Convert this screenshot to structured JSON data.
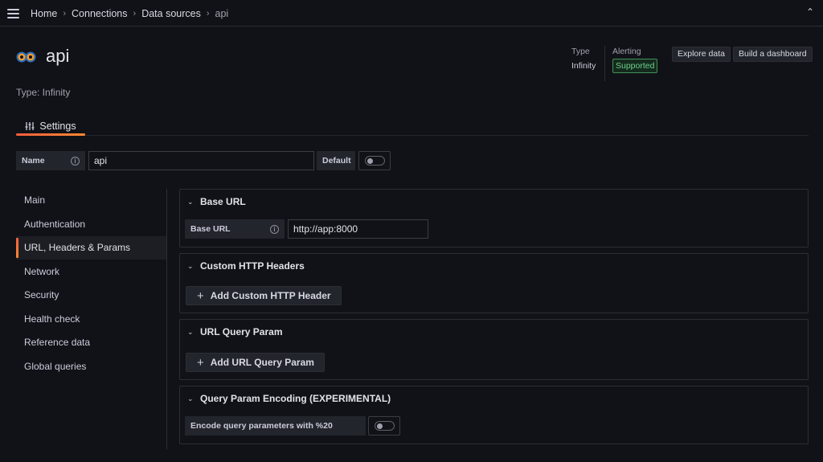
{
  "breadcrumb": {
    "home": "Home",
    "connections": "Connections",
    "data_sources": "Data sources",
    "current": "api"
  },
  "header": {
    "title": "api",
    "type_line": "Type: Infinity",
    "meta_type_label": "Type",
    "meta_type_value": "Infinity",
    "meta_alerting_label": "Alerting",
    "meta_alerting_badge": "Supported",
    "explore_button": "Explore data",
    "dashboard_button": "Build a dashboard"
  },
  "tabs": {
    "settings": "Settings"
  },
  "name_row": {
    "name_label": "Name",
    "name_value": "api",
    "default_label": "Default"
  },
  "side_nav": {
    "items": [
      "Main",
      "Authentication",
      "URL, Headers & Params",
      "Network",
      "Security",
      "Health check",
      "Reference data",
      "Global queries"
    ],
    "active_index": 2
  },
  "sections": {
    "base_url": {
      "title": "Base URL",
      "field_label": "Base URL",
      "field_value": "http://app:8000"
    },
    "headers": {
      "title": "Custom HTTP Headers",
      "button": "Add Custom HTTP Header"
    },
    "query": {
      "title": "URL Query Param",
      "button": "Add URL Query Param"
    },
    "encoding": {
      "title": "Query Param Encoding (EXPERIMENTAL)",
      "field_label": "Encode query parameters with %20"
    }
  },
  "colors": {
    "background": "#111217",
    "accent": "#f55f3e",
    "badge_green": "#6ccf8e"
  }
}
